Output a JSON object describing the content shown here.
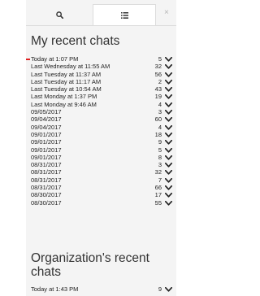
{
  "tabs": {
    "search_icon": "search-icon",
    "list_icon": "list-icon",
    "close": "×"
  },
  "my_recent_chats": {
    "heading": "My recent chats",
    "rows": [
      {
        "when": "Today at 1:07 PM",
        "count": "5",
        "active": true
      },
      {
        "when": "Last Wednesday at 11:55 AM",
        "count": "32"
      },
      {
        "when": "Last Tuesday at 11:37 AM",
        "count": "56"
      },
      {
        "when": "Last Tuesday at 11:17 AM",
        "count": "2"
      },
      {
        "when": "Last Tuesday at 10:54 AM",
        "count": "43"
      },
      {
        "when": "Last Monday at 1:37 PM",
        "count": "19"
      },
      {
        "when": "Last Monday at 9:46 AM",
        "count": "4"
      },
      {
        "when": "09/05/2017",
        "count": "3"
      },
      {
        "when": "09/04/2017",
        "count": "60"
      },
      {
        "when": "09/04/2017",
        "count": "4"
      },
      {
        "when": "09/01/2017",
        "count": "18"
      },
      {
        "when": "09/01/2017",
        "count": "9"
      },
      {
        "when": "09/01/2017",
        "count": "5"
      },
      {
        "when": "09/01/2017",
        "count": "8"
      },
      {
        "when": "08/31/2017",
        "count": "3"
      },
      {
        "when": "08/31/2017",
        "count": "32"
      },
      {
        "when": "08/31/2017",
        "count": "7"
      },
      {
        "when": "08/31/2017",
        "count": "66"
      },
      {
        "when": "08/30/2017",
        "count": "17"
      },
      {
        "when": "08/30/2017",
        "count": "55"
      }
    ]
  },
  "organization_recent_chats": {
    "heading": "Organization's recent chats",
    "rows": [
      {
        "when": "Today at 1:43 PM",
        "count": "9"
      }
    ]
  },
  "colors": {
    "panel_bg": "#f4f4f4",
    "active_marker": "#e02020"
  }
}
